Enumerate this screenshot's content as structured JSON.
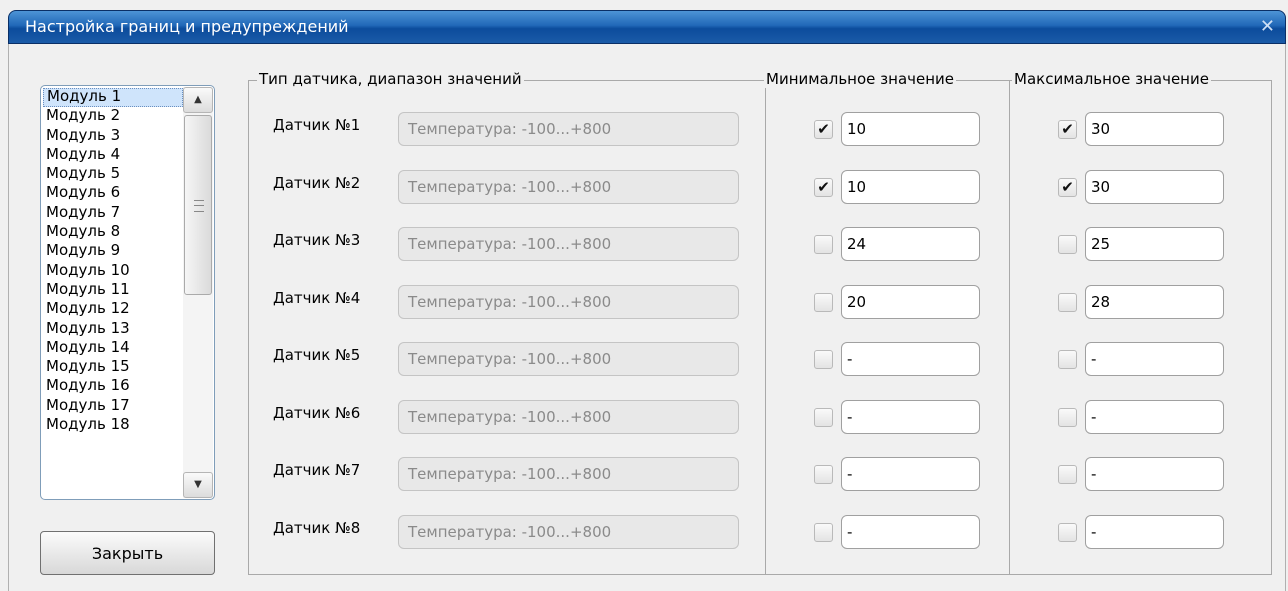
{
  "window": {
    "title": "Настройка границ и предупреждений",
    "close_icon": "close-icon"
  },
  "modules": {
    "items": [
      "Модуль 1",
      "Модуль 2",
      "Модуль 3",
      "Модуль 4",
      "Модуль 5",
      "Модуль 6",
      "Модуль 7",
      "Модуль 8",
      "Модуль 9",
      "Модуль 10",
      "Модуль 11",
      "Модуль 12",
      "Модуль 13",
      "Модуль 14",
      "Модуль 15",
      "Модуль 16",
      "Модуль 17",
      "Модуль 18"
    ],
    "selected": "Модуль 1"
  },
  "buttons": {
    "close_label": "Закрыть"
  },
  "groups": {
    "sensor_type": "Тип датчика, диапазон значений",
    "min_value": "Минимальное значение",
    "max_value": "Максимальное значение"
  },
  "sensors": [
    {
      "label": "Датчик №1",
      "range": "Температура: -100...+800",
      "min_checked": true,
      "min": "10",
      "max_checked": true,
      "max": "30"
    },
    {
      "label": "Датчик №2",
      "range": "Температура: -100...+800",
      "min_checked": true,
      "min": "10",
      "max_checked": true,
      "max": "30"
    },
    {
      "label": "Датчик №3",
      "range": "Температура: -100...+800",
      "min_checked": false,
      "min": "24",
      "max_checked": false,
      "max": "25"
    },
    {
      "label": "Датчик №4",
      "range": "Температура: -100...+800",
      "min_checked": false,
      "min": "20",
      "max_checked": false,
      "max": "28"
    },
    {
      "label": "Датчик №5",
      "range": "Температура: -100...+800",
      "min_checked": false,
      "min": "-",
      "max_checked": false,
      "max": "-"
    },
    {
      "label": "Датчик №6",
      "range": "Температура: -100...+800",
      "min_checked": false,
      "min": "-",
      "max_checked": false,
      "max": "-"
    },
    {
      "label": "Датчик №7",
      "range": "Температура: -100...+800",
      "min_checked": false,
      "min": "-",
      "max_checked": false,
      "max": "-"
    },
    {
      "label": "Датчик №8",
      "range": "Температура: -100...+800",
      "min_checked": false,
      "min": "-",
      "max_checked": false,
      "max": "-"
    }
  ]
}
